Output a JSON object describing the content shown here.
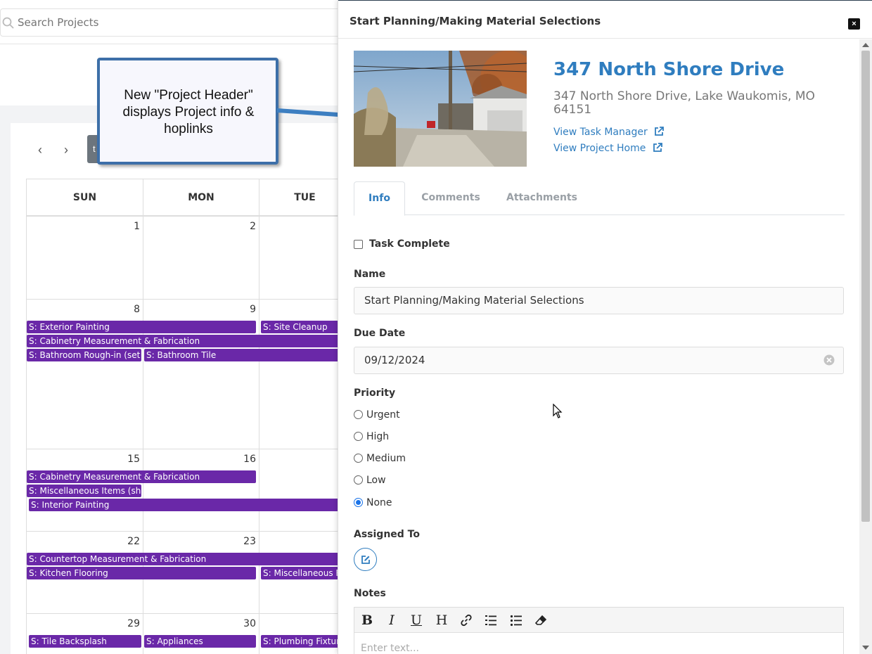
{
  "background_app": {
    "search_placeholder": "Search Projects",
    "nav_prev": "‹",
    "nav_next": "›",
    "today_label": "t",
    "calendar": {
      "headers": [
        "SUN",
        "MON",
        "TUE"
      ],
      "weeks": [
        {
          "days": [
            "1",
            "2",
            ""
          ],
          "events": []
        },
        {
          "days": [
            "8",
            "9",
            ""
          ],
          "events": [
            "S:  Exterior Painting",
            "S:  Site Cleanup",
            "S:  Cabinetry Measurement & Fabrication",
            "S:  Bathroom Rough-in (set t",
            "S:  Bathroom Tile"
          ]
        },
        {
          "days": [
            "15",
            "16",
            ""
          ],
          "events": [
            "S:  Cabinetry Measurement & Fabrication",
            "S:  Miscellaneous Items (shu",
            "S:  Interior Painting"
          ]
        },
        {
          "days": [
            "22",
            "23",
            ""
          ],
          "events": [
            "S:  Countertop Measurement & Fabrication",
            "S:  Kitchen Flooring",
            "S:  Miscellaneous F"
          ]
        },
        {
          "days": [
            "29",
            "30",
            ""
          ],
          "events": [
            "S:  Tile Backsplash",
            "S:  Appliances",
            "S:  Plumbing Fixtur"
          ]
        }
      ]
    }
  },
  "callout": {
    "text": "New \"Project Header\" displays Project info & hoplinks"
  },
  "panel": {
    "title": "Start Planning/Making Material Selections",
    "close_label": "×",
    "project": {
      "name": "347 North Shore Drive",
      "address": "347 North Shore Drive, Lake Waukomis, MO 64151",
      "link_task_manager": "View Task Manager",
      "link_project_home": "View Project Home"
    },
    "tabs": [
      {
        "label": "Info",
        "active": true
      },
      {
        "label": "Comments",
        "active": false
      },
      {
        "label": "Attachments",
        "active": false
      }
    ],
    "task_complete_label": "Task Complete",
    "task_complete_checked": false,
    "name_label": "Name",
    "name_value": "Start Planning/Making Material Selections",
    "due_date_label": "Due Date",
    "due_date_value": "09/12/2024",
    "priority_label": "Priority",
    "priority_options": [
      "Urgent",
      "High",
      "Medium",
      "Low",
      "None"
    ],
    "priority_selected": "None",
    "assigned_to_label": "Assigned To",
    "notes_label": "Notes",
    "notes_placeholder": "Enter text...",
    "toolbar": {
      "bold": "B",
      "italic": "I",
      "underline": "U",
      "heading": "H"
    }
  },
  "colors": {
    "accent_blue": "#2f7dbf",
    "event_purple": "#6a28a8",
    "callout_border": "#3d6fa8",
    "radio_selected": "#1a73e8"
  }
}
